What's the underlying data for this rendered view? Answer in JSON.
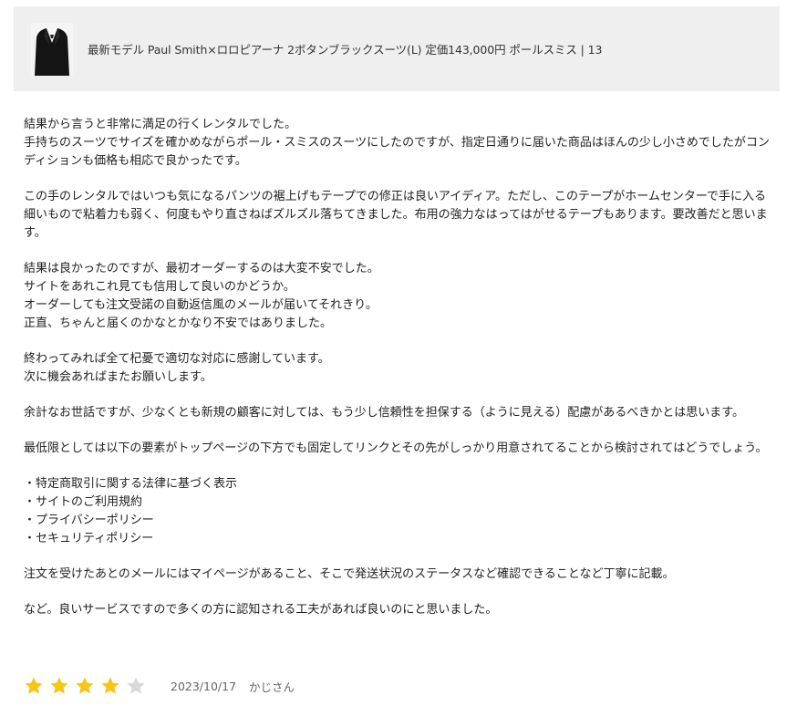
{
  "product": {
    "title": "最新モデル Paul Smith×ロロピアーナ 2ボタンブラックスーツ(L) 定価143,000円 ポールスミス | 13",
    "image_icon": "black-suit-thumbnail"
  },
  "review": {
    "paragraphs": [
      "結果から言うと非常に満足の行くレンタルでした。\n手持ちのスーツでサイズを確かめながらポール・スミスのスーツにしたのですが、指定日通りに届いた商品はほんの少し小さめでしたがコンディションも価格も相応で良かったです。",
      "この手のレンタルではいつも気になるパンツの裾上げもテープでの修正は良いアイディア。ただし、このテープがホームセンターで手に入る細いもので粘着力も弱く、何度もやり直さねばズルズル落ちてきました。布用の強力なはってはがせるテープもあります。要改善だと思います。",
      "結果は良かったのですが、最初オーダーするのは大変不安でした。\nサイトをあれこれ見ても信用して良いのかどうか。\nオーダーしても注文受諾の自動返信風のメールが届いてそれきり。\n正直、ちゃんと届くのかなとかなり不安ではありました。",
      "終わってみれば全て杞憂で適切な対応に感謝しています。\n次に機会あればまたお願いします。",
      "余計なお世話ですが、少なくとも新規の顧客に対しては、もう少し信頼性を担保する（ように見える）配慮があるべきかとは思います。",
      "最低限としては以下の要素がトップページの下方でも固定してリンクとその先がしっかり用意されてることから検討されてはどうでしょう。",
      "・特定商取引に関する法律に基づく表示\n・サイトのご利用規約\n・プライバシーポリシー\n・セキュリティポリシー",
      "注文を受けたあとのメールにはマイページがあること、そこで発送状況のステータスなど確認できることなど丁寧に記載。",
      "など。良いサービスですので多くの方に認知される工夫があれば良いのにと思いました。"
    ],
    "rating": 4,
    "rating_max": 5,
    "star_filled_color": "#f5c518",
    "star_empty_color": "#d9d9d9",
    "date": "2023/10/17",
    "author": "かじさん"
  }
}
